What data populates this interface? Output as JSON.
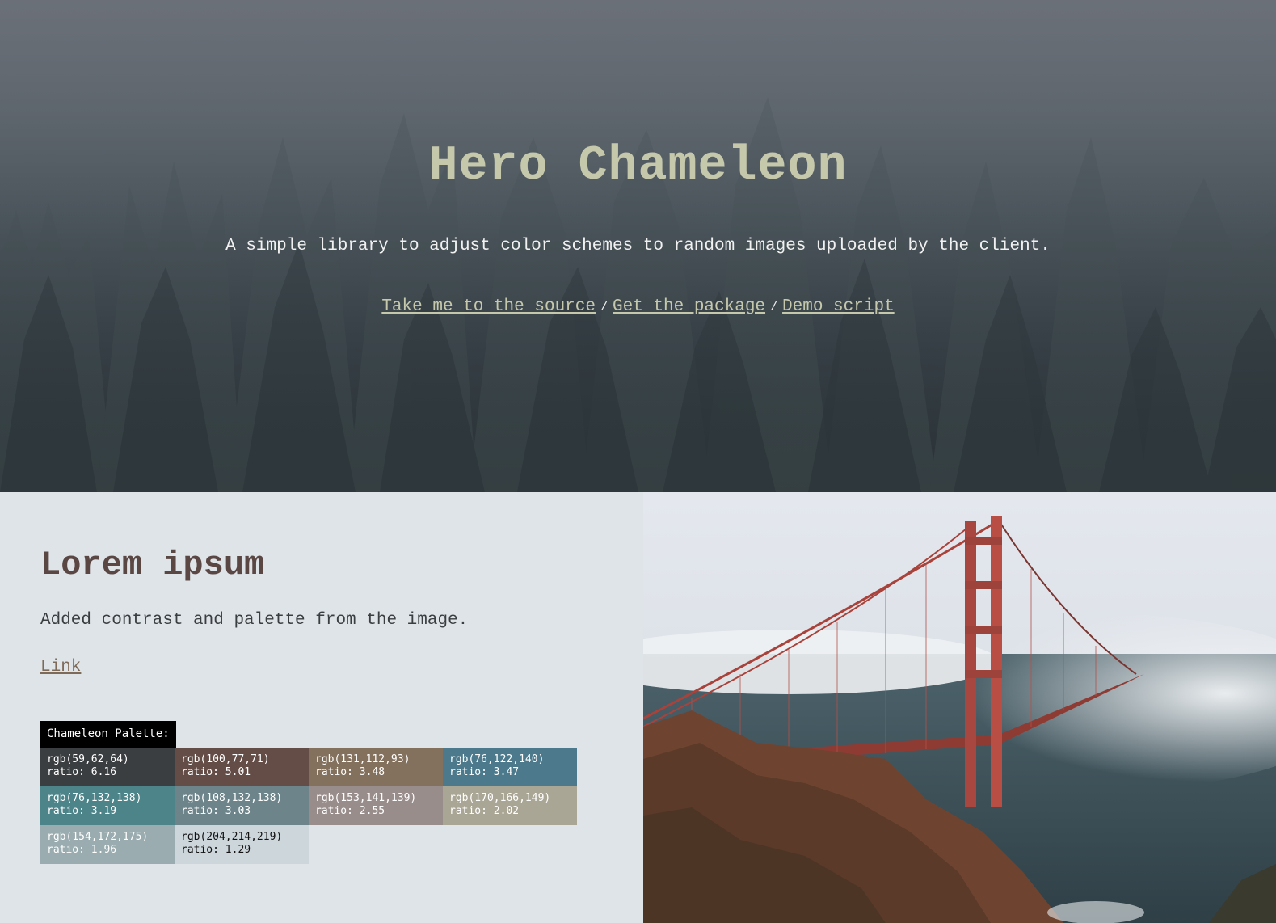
{
  "hero": {
    "title": "Hero Chameleon",
    "subtitle": "A simple library to adjust color schemes to random images uploaded by the client.",
    "links": [
      {
        "label": "Take me to the source"
      },
      {
        "label": "Get the package"
      },
      {
        "label": "Demo script"
      }
    ],
    "separator": "/",
    "colors": {
      "title": "#c5c8ab",
      "link": "#c5c8ab"
    }
  },
  "content": {
    "title": "Lorem ipsum",
    "text": "Added contrast and palette from the image.",
    "link_label": "Link",
    "palette_label": "Chameleon Palette:",
    "palette": [
      {
        "rgb": "rgb(59,62,64)",
        "ratio": "ratio: 6.16",
        "bg": "#3b3e40",
        "fg": "#ffffff"
      },
      {
        "rgb": "rgb(100,77,71)",
        "ratio": "ratio: 5.01",
        "bg": "#644d47",
        "fg": "#ffffff"
      },
      {
        "rgb": "rgb(131,112,93)",
        "ratio": "ratio: 3.48",
        "bg": "#83705d",
        "fg": "#ffffff"
      },
      {
        "rgb": "rgb(76,122,140)",
        "ratio": "ratio: 3.47",
        "bg": "#4c7a8c",
        "fg": "#ffffff"
      },
      {
        "rgb": "rgb(76,132,138)",
        "ratio": "ratio: 3.19",
        "bg": "#4c848a",
        "fg": "#ffffff"
      },
      {
        "rgb": "rgb(108,132,138)",
        "ratio": "ratio: 3.03",
        "bg": "#6c848a",
        "fg": "#ffffff"
      },
      {
        "rgb": "rgb(153,141,139)",
        "ratio": "ratio: 2.55",
        "bg": "#998d8b",
        "fg": "#ffffff"
      },
      {
        "rgb": "rgb(170,166,149)",
        "ratio": "ratio: 2.02",
        "bg": "#aaa695",
        "fg": "#ffffff"
      },
      {
        "rgb": "rgb(154,172,175)",
        "ratio": "ratio: 1.96",
        "bg": "#9aacaf",
        "fg": "#ffffff"
      },
      {
        "rgb": "rgb(204,214,219)",
        "ratio": "ratio: 1.29",
        "bg": "#ccd6db",
        "fg": "#111111"
      }
    ]
  }
}
